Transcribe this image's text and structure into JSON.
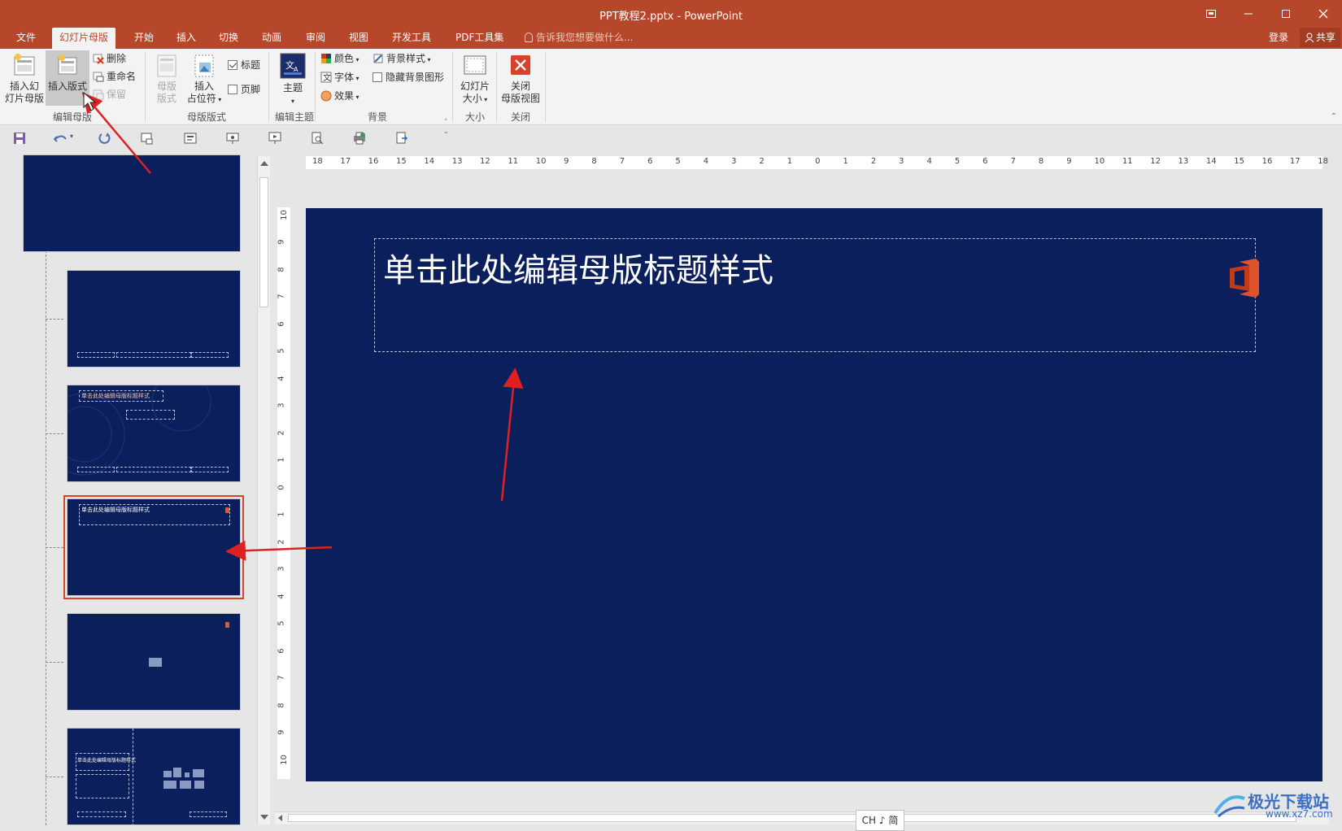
{
  "window": {
    "title": "PPT教程2.pptx - PowerPoint",
    "controls": [
      "restore-ribbon",
      "minimize",
      "maximize",
      "close"
    ]
  },
  "tabs": [
    {
      "label": "文件",
      "active": false
    },
    {
      "label": "幻灯片母版",
      "active": true
    },
    {
      "label": "开始",
      "active": false
    },
    {
      "label": "插入",
      "active": false
    },
    {
      "label": "切换",
      "active": false
    },
    {
      "label": "动画",
      "active": false
    },
    {
      "label": "审阅",
      "active": false
    },
    {
      "label": "视图",
      "active": false
    },
    {
      "label": "开发工具",
      "active": false
    },
    {
      "label": "PDF工具集",
      "active": false
    }
  ],
  "tell_me": "告诉我您想要做什么...",
  "account": {
    "login": "登录",
    "share": "共享"
  },
  "ribbon": {
    "edit_master": {
      "group_label": "编辑母版",
      "insert_slide_master_line1": "插入幻",
      "insert_slide_master_line2": "灯片母版",
      "insert_layout": "插入版式",
      "delete": "删除",
      "rename": "重命名",
      "preserve": "保留"
    },
    "master_layout": {
      "group_label": "母版版式",
      "master_layout_line1": "母版",
      "master_layout_line2": "版式",
      "insert_placeholder_line1": "插入",
      "insert_placeholder_line2": "占位符",
      "title_checkbox": "标题",
      "title_checked": true,
      "footer_checkbox": "页脚",
      "footer_checked": false
    },
    "edit_theme": {
      "group_label": "编辑主题",
      "theme": "主题"
    },
    "background": {
      "group_label": "背景",
      "colors": "颜色",
      "fonts": "字体",
      "effects": "效果",
      "background_styles": "背景样式",
      "hide_background_graphics": "隐藏背景图形",
      "hide_checked": false
    },
    "size": {
      "group_label": "大小",
      "slide_size_line1": "幻灯片",
      "slide_size_line2": "大小"
    },
    "close": {
      "group_label": "关闭",
      "close_master_line1": "关闭",
      "close_master_line2": "母版视图"
    }
  },
  "thumbnails": {
    "thumb3_title": "单击此处编辑母版标题样式",
    "thumb4_title": "单击此处编辑母版标题样式",
    "thumb6_title": "单击此处编辑母版标题样式"
  },
  "slide": {
    "title_placeholder": "单击此处编辑母版标题样式",
    "background": "#0b1f5c"
  },
  "ruler": {
    "horizontal": [
      "18",
      "17",
      "16",
      "15",
      "14",
      "13",
      "12",
      "11",
      "10",
      "9",
      "8",
      "7",
      "6",
      "5",
      "4",
      "3",
      "2",
      "1",
      "0",
      "1",
      "2",
      "3",
      "4",
      "5",
      "6",
      "7",
      "8",
      "9",
      "10",
      "11",
      "12",
      "13",
      "14",
      "15",
      "16",
      "17",
      "18"
    ],
    "vertical": [
      "10",
      "9",
      "8",
      "7",
      "6",
      "5",
      "4",
      "3",
      "2",
      "1",
      "0",
      "1",
      "2",
      "3",
      "4",
      "5",
      "6",
      "7",
      "8",
      "9",
      "10"
    ]
  },
  "ime_indicator": "CH ♪ 简",
  "watermark": {
    "text": "极光下载站",
    "url": "www.xz7.com"
  },
  "colors": {
    "accent": "#b7472a",
    "slide_bg": "#0b1f5c",
    "annotation_arrow": "#e02020",
    "selected_outline": "#d24726"
  }
}
